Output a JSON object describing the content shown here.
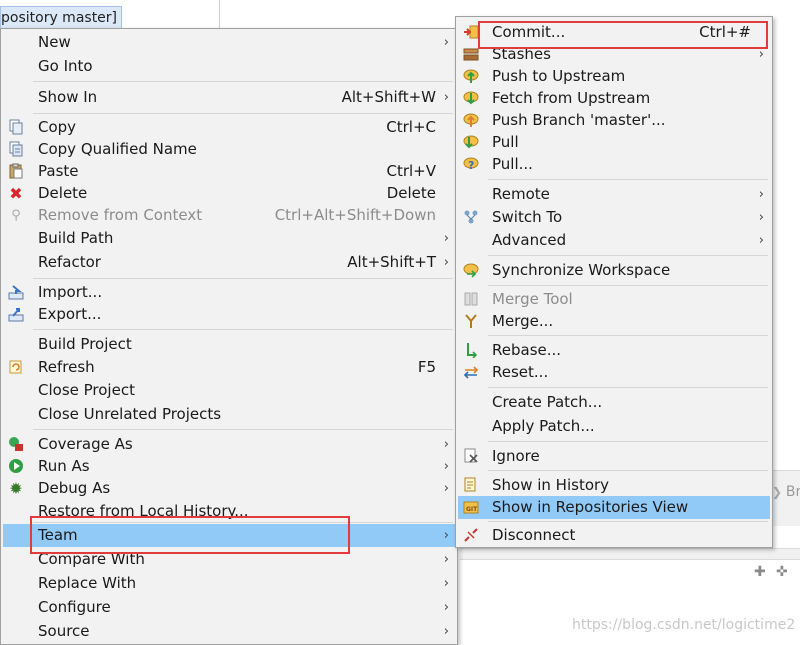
{
  "background": {
    "tab_label": "pository master]",
    "breadcrumb_fragment": "Bre",
    "watermark": "https://blog.csdn.net/logictime2"
  },
  "context_menu": {
    "items": [
      {
        "label": "New",
        "submenu": true
      },
      {
        "label": "Go Into"
      },
      {
        "label": "Show In",
        "shortcut": "Alt+Shift+W",
        "submenu": true
      },
      {
        "label": "Copy",
        "shortcut": "Ctrl+C",
        "icon": "copy-icon"
      },
      {
        "label": "Copy Qualified Name",
        "icon": "copy-qualified-name-icon"
      },
      {
        "label": "Paste",
        "shortcut": "Ctrl+V",
        "icon": "paste-icon"
      },
      {
        "label": "Delete",
        "shortcut": "Delete",
        "icon": "delete-icon"
      },
      {
        "label": "Remove from Context",
        "shortcut": "Ctrl+Alt+Shift+Down",
        "icon": "remove-context-icon",
        "disabled": true
      },
      {
        "label": "Build Path",
        "submenu": true
      },
      {
        "label": "Refactor",
        "shortcut": "Alt+Shift+T",
        "submenu": true
      },
      {
        "label": "Import...",
        "icon": "import-icon"
      },
      {
        "label": "Export...",
        "icon": "export-icon"
      },
      {
        "label": "Build Project"
      },
      {
        "label": "Refresh",
        "shortcut": "F5",
        "icon": "refresh-icon"
      },
      {
        "label": "Close Project"
      },
      {
        "label": "Close Unrelated Projects"
      },
      {
        "label": "Coverage As",
        "icon": "coverage-icon",
        "submenu": true
      },
      {
        "label": "Run As",
        "icon": "run-icon",
        "submenu": true
      },
      {
        "label": "Debug As",
        "icon": "debug-icon",
        "submenu": true
      },
      {
        "label": "Restore from Local History..."
      },
      {
        "label": "Team",
        "submenu": true,
        "selected": true
      },
      {
        "label": "Compare With",
        "submenu": true
      },
      {
        "label": "Replace With",
        "submenu": true
      },
      {
        "label": "Configure",
        "submenu": true
      },
      {
        "label": "Source",
        "submenu": true
      }
    ]
  },
  "team_submenu": {
    "items": [
      {
        "label": "Commit...",
        "shortcut": "Ctrl+#",
        "icon": "commit-icon"
      },
      {
        "label": "Stashes",
        "icon": "stashes-icon",
        "submenu": true
      },
      {
        "label": "Push to Upstream",
        "icon": "push-upstream-icon"
      },
      {
        "label": "Fetch from Upstream",
        "icon": "fetch-upstream-icon"
      },
      {
        "label": "Push Branch 'master'...",
        "icon": "push-branch-icon"
      },
      {
        "label": "Pull",
        "icon": "pull-icon"
      },
      {
        "label": "Pull...",
        "icon": "pull-dialog-icon"
      },
      {
        "label": "Remote",
        "submenu": true
      },
      {
        "label": "Switch To",
        "icon": "switch-to-icon",
        "submenu": true
      },
      {
        "label": "Advanced",
        "submenu": true
      },
      {
        "label": "Synchronize Workspace",
        "icon": "synchronize-icon"
      },
      {
        "label": "Merge Tool",
        "icon": "merge-tool-icon",
        "disabled": true
      },
      {
        "label": "Merge...",
        "icon": "merge-icon"
      },
      {
        "label": "Rebase...",
        "icon": "rebase-icon"
      },
      {
        "label": "Reset...",
        "icon": "reset-icon"
      },
      {
        "label": "Create Patch..."
      },
      {
        "label": "Apply Patch..."
      },
      {
        "label": "Ignore",
        "icon": "ignore-icon"
      },
      {
        "label": "Show in History",
        "icon": "history-icon"
      },
      {
        "label": "Show in Repositories View",
        "icon": "repositories-view-icon",
        "selected": true
      },
      {
        "label": "Disconnect",
        "icon": "disconnect-icon"
      }
    ]
  },
  "colors": {
    "menu_background": "#f2f2f2",
    "selection": "#91c9f7",
    "highlight_box": "#e23b3b",
    "disabled_text": "#8c8c8c"
  }
}
